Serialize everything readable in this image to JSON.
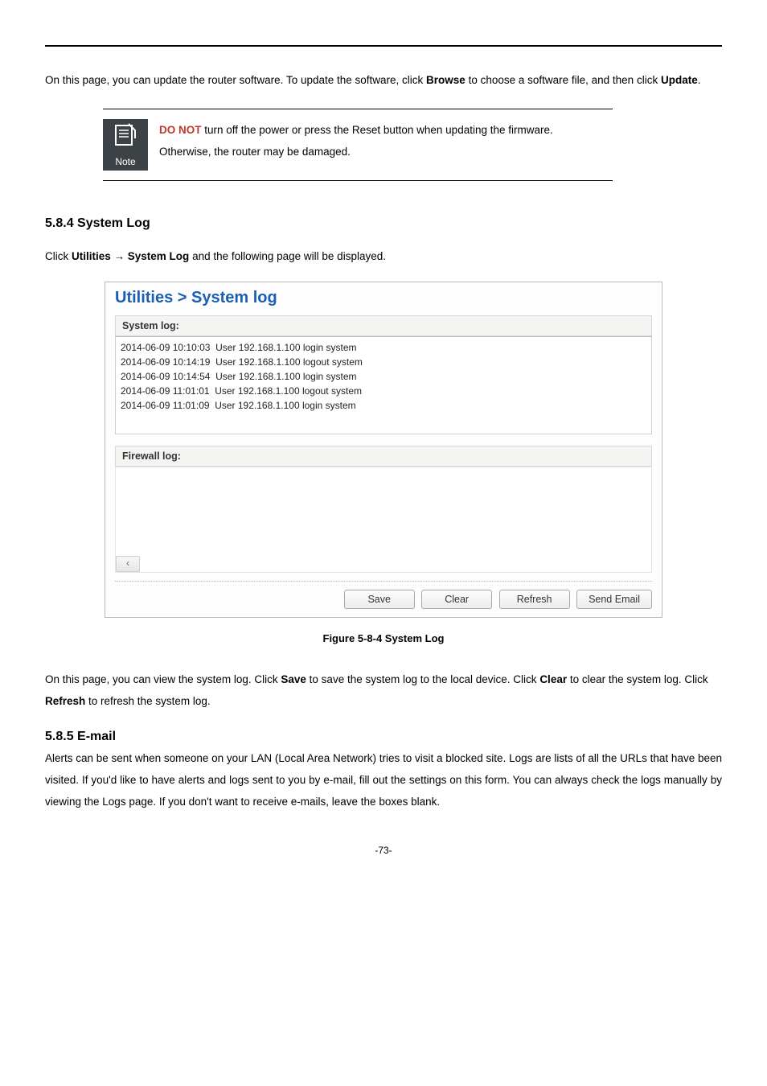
{
  "intro": {
    "line1_a": "On this page, you can update the router software. To update the software, click ",
    "browse": "Browse",
    "line1_b": " to choose a software file, and then click ",
    "update": "Update",
    "period": "."
  },
  "note": {
    "icon_label": "Note",
    "do_not": "DO NOT",
    "line1_rest": " turn off the power or press the Reset button when updating the firmware.",
    "line2": "Otherwise, the router may be damaged."
  },
  "h584": "5.8.4  System Log",
  "click_line": {
    "a": "Click ",
    "utilities": "Utilities",
    "arrow": " → ",
    "syslog": "System Log",
    "b": " and the following page will be displayed."
  },
  "screenshot": {
    "title": "Utilities > System log",
    "section_system": "System log:",
    "log_text": "2014-06-09 10:10:03  User 192.168.1.100 login system\n2014-06-09 10:14:19  User 192.168.1.100 logout system\n2014-06-09 10:14:54  User 192.168.1.100 login system\n2014-06-09 11:01:01  User 192.168.1.100 logout system\n2014-06-09 11:01:09  User 192.168.1.100 login system",
    "section_firewall": "Firewall log:",
    "scroll_glyph": "‹",
    "buttons": {
      "save": "Save",
      "clear": "Clear",
      "refresh": "Refresh",
      "send_email": "Send Email"
    }
  },
  "caption": "Figure 5-8-4 System Log",
  "para2": {
    "a": "On this page, you can view the system log. Click ",
    "save": "Save",
    "b": " to save the system log to the local device. Click ",
    "clear": "Clear",
    "c": " to clear the system log. Click ",
    "refresh": "Refresh",
    "d": " to refresh the system log."
  },
  "h585": "5.8.5  E-mail",
  "email_para": "Alerts can be sent when someone on your LAN (Local Area Network) tries to visit a blocked site. Logs are lists of all the URLs that have been visited. If you'd like to have alerts and logs sent to you by e-mail, fill out the settings on this form. You can always check the logs manually by viewing the Logs page. If you don't want to receive e-mails, leave the boxes blank.",
  "page_num": "-73-"
}
